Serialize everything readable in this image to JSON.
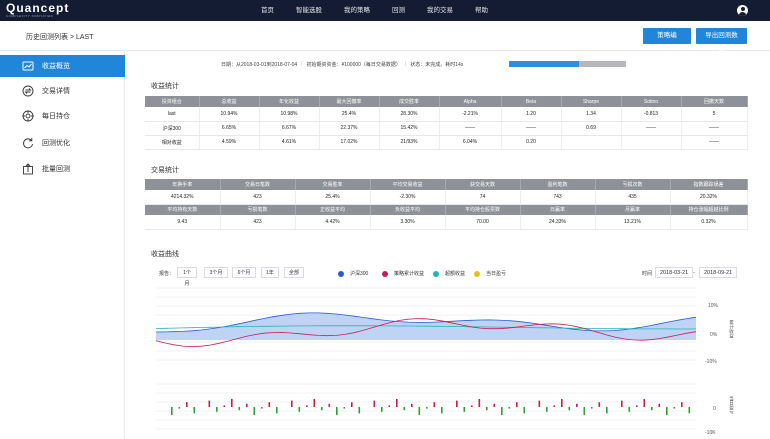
{
  "brand": {
    "logo": "Quancept",
    "tagline": "COMPLEXITY SIMPLIFIED"
  },
  "nav": [
    "首页",
    "智能选股",
    "我的策略",
    "回测",
    "我的交易",
    "帮助"
  ],
  "breadcrumb": "历史回测列表 > LAST",
  "buttons": {
    "strategy": "策略编",
    "export": "导出回测数据"
  },
  "sidebar": [
    {
      "label": "收益概览",
      "icon": "chart-icon",
      "active": true
    },
    {
      "label": "交易详情",
      "icon": "exchange-icon",
      "active": false
    },
    {
      "label": "每日持仓",
      "icon": "target-icon",
      "active": false
    },
    {
      "label": "回测优化",
      "icon": "refresh-icon",
      "active": false
    },
    {
      "label": "批量回测",
      "icon": "upload-icon",
      "active": false
    }
  ],
  "info": {
    "date": "日期：从2018-03-01到2018-07-04",
    "capital": "初始期资资金：¥100000（每日交易数据）",
    "status": "状态：未完成。耗时14s",
    "progress": 0.6
  },
  "returns": {
    "title": "收益统计",
    "headers": [
      "投资组合",
      "总收益",
      "年化收益",
      "最大回撤率",
      "成交胜率",
      "Alpha",
      "Beta",
      "Sharpe",
      "Sotino",
      "回撤天数"
    ],
    "rows": [
      [
        "last",
        "10.94%",
        "10.98%",
        "25.4%",
        "28.30%",
        "-2.21%",
        "1.20",
        "1.34",
        "-0.813",
        "5"
      ],
      [
        "沪深300",
        "6.65%",
        "6.67%",
        "22.37%",
        "15.42%",
        "——",
        "——",
        "0.69",
        "——",
        "——"
      ],
      [
        "相对收益",
        "4.59%",
        "4.61%",
        "17.02%",
        "21/93%",
        "6.04%",
        "0.20",
        "",
        "",
        "——"
      ]
    ]
  },
  "trades": {
    "title": "交易统计",
    "headers1": [
      "年换手率",
      "交易日笔数",
      "交易胜率",
      "平均交易收益",
      "获交易天数",
      "盈利笔数",
      "亏损次数",
      "指数跟踪误差"
    ],
    "row1": [
      "4214.32%",
      "423",
      "25.4%",
      "-2.30%",
      "74",
      "743",
      "435",
      "20.32%"
    ],
    "headers2": [
      "平均持有天数",
      "亏损笔数",
      "正收益平均",
      "负收益平均",
      "平均持仓股票数",
      "日赢率",
      "月赢率",
      "持仓涨幅超越比例"
    ],
    "row2": [
      "9.43",
      "423",
      "4.42%",
      "3.30%",
      "70.00",
      "24.33%",
      "13.21%",
      "0.32%"
    ]
  },
  "curve": {
    "title": "收益曲线",
    "period_label": "报告：",
    "periods": [
      "1个月",
      "3个月",
      "6个月",
      "1年",
      "全部"
    ],
    "legend": [
      {
        "name": "沪深300",
        "color": "#2a5bd7"
      },
      {
        "name": "策略累计收益",
        "color": "#c81e54"
      },
      {
        "name": "超额收益",
        "color": "#20b5b5"
      },
      {
        "name": "当日盈亏",
        "color": "#e0c21c"
      }
    ],
    "time_label": "时间",
    "date_from": "2018-03-21",
    "date_to": "2018-09-21",
    "dash": "-",
    "y_ticks_top": [
      "10%",
      "0%",
      "-10%"
    ],
    "y_label_top": "累计收益",
    "y_ticks_bottom": [
      "0",
      "-10K"
    ],
    "y_label_bottom": "当日盈亏"
  }
}
